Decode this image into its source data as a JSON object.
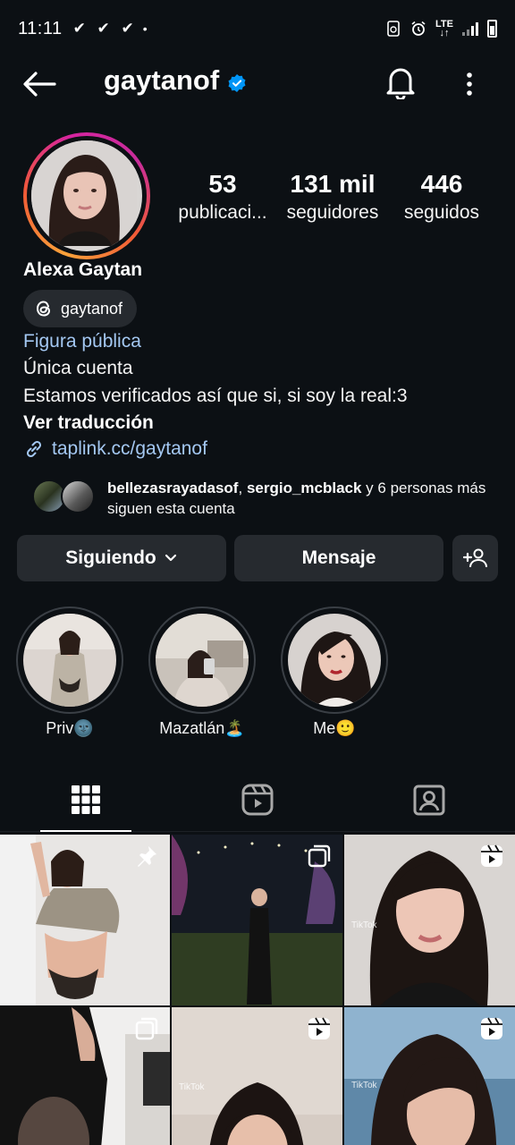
{
  "status_bar": {
    "time": "11:11",
    "checks": "✔ ✔ ✔",
    "dot": "•",
    "network": "LTE"
  },
  "header": {
    "username": "gaytanof",
    "verified": true,
    "icons": [
      "back-arrow-icon",
      "verified-badge-icon",
      "bell-icon",
      "more-vertical-icon"
    ]
  },
  "profile": {
    "stats": [
      {
        "value": "53",
        "label": "publicaci..."
      },
      {
        "value": "131 mil",
        "label": "seguidores"
      },
      {
        "value": "446",
        "label": "seguidos"
      }
    ],
    "full_name": "Alexa Gaytan",
    "threads_handle": "gaytanof",
    "category": "Figura pública",
    "bio": [
      "Única cuenta",
      "Estamos verificados así que si, si soy la real:3"
    ],
    "translate": "Ver traducción",
    "link": "taplink.cc/gaytanof"
  },
  "followed_by": {
    "user1": "bellezasrayadasof",
    "separator": ",",
    "user2": "sergio_mcblack",
    "rest": " y 6 personas más siguen esta cuenta"
  },
  "actions": {
    "following_label": "Siguiendo",
    "message_label": "Mensaje"
  },
  "highlights": [
    {
      "label": "Priv🌚"
    },
    {
      "label": "Mazatlán🏝️"
    },
    {
      "label": "Me🙂"
    }
  ],
  "tabs": [
    "grid-icon",
    "reels-icon",
    "tagged-icon"
  ],
  "posts": [
    {
      "badge": "pin-icon"
    },
    {
      "badge": "carousel-icon"
    },
    {
      "badge": "reel-icon",
      "overlay": "TikTok"
    },
    {
      "badge": "carousel-icon"
    },
    {
      "badge": "reel-icon",
      "overlay": "TikTok"
    },
    {
      "badge": "reel-icon",
      "overlay": "TikTok"
    }
  ],
  "colors": {
    "background": "#0c1014",
    "button": "#262a2f",
    "link": "#a4c8f2",
    "verified": "#0095f6"
  }
}
